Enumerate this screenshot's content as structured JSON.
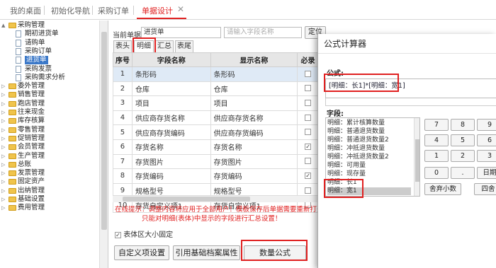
{
  "top_tabs": [
    "我的桌面",
    "初始化导航",
    "采购订单",
    "单据设计"
  ],
  "tree": [
    {
      "label": "采购管理",
      "type": "folder",
      "depth": 1,
      "expand": "▲"
    },
    {
      "label": "期初进货单",
      "type": "doc",
      "depth": 2
    },
    {
      "label": "请购单",
      "type": "doc",
      "depth": 2
    },
    {
      "label": "采购订单",
      "type": "doc",
      "depth": 2
    },
    {
      "label": "进货单",
      "type": "doc",
      "depth": 2,
      "selected": true
    },
    {
      "label": "采购发票",
      "type": "doc",
      "depth": 2
    },
    {
      "label": "采购需求分析",
      "type": "doc",
      "depth": 2
    },
    {
      "label": "委外管理",
      "type": "folder",
      "depth": 1,
      "expand": "▷"
    },
    {
      "label": "销售管理",
      "type": "folder",
      "depth": 1,
      "expand": "▷"
    },
    {
      "label": "跑店管理",
      "type": "folder",
      "depth": 1,
      "expand": "▷"
    },
    {
      "label": "往来现金",
      "type": "folder",
      "depth": 1,
      "expand": "▷"
    },
    {
      "label": "库存核算",
      "type": "folder",
      "depth": 1,
      "expand": "▷"
    },
    {
      "label": "零售管理",
      "type": "folder",
      "depth": 1,
      "expand": "▷"
    },
    {
      "label": "促销管理",
      "type": "folder",
      "depth": 1,
      "expand": "▷"
    },
    {
      "label": "会员管理",
      "type": "folder",
      "depth": 1,
      "expand": "▷"
    },
    {
      "label": "生产管理",
      "type": "folder",
      "depth": 1,
      "expand": "▷"
    },
    {
      "label": "总账",
      "type": "folder",
      "depth": 1,
      "expand": "▷"
    },
    {
      "label": "发票管理",
      "type": "folder",
      "depth": 1,
      "expand": "▷"
    },
    {
      "label": "固定资产",
      "type": "folder",
      "depth": 1,
      "expand": "▷"
    },
    {
      "label": "出纳管理",
      "type": "folder",
      "depth": 1,
      "expand": "▷"
    },
    {
      "label": "基础设置",
      "type": "folder",
      "depth": 1,
      "expand": "▷"
    },
    {
      "label": "费用管理",
      "type": "folder",
      "depth": 1,
      "expand": "▷"
    }
  ],
  "main": {
    "current_label": "当前单据",
    "current_value": "进货单",
    "field_placeholder": "请输入字段名称",
    "locate_label": "定位",
    "subtabs": [
      "表头",
      "明细",
      "汇总",
      "表尾"
    ],
    "columns": [
      "序号",
      "字段名称",
      "显示名称",
      "必录"
    ],
    "rows": [
      {
        "no": "1",
        "field": "条形码",
        "display": "条形码",
        "req": false,
        "hl": true
      },
      {
        "no": "2",
        "field": "仓库",
        "display": "仓库",
        "req": false
      },
      {
        "no": "3",
        "field": "项目",
        "display": "项目",
        "req": false
      },
      {
        "no": "4",
        "field": "供应商存货名称",
        "display": "供应商存货名称",
        "req": false
      },
      {
        "no": "5",
        "field": "供应商存货编码",
        "display": "供应商存货编码",
        "req": false
      },
      {
        "no": "6",
        "field": "存货名称",
        "display": "存货名称",
        "req": true
      },
      {
        "no": "7",
        "field": "存货图片",
        "display": "存货图片",
        "req": false
      },
      {
        "no": "8",
        "field": "存货编码",
        "display": "存货编码",
        "req": true
      },
      {
        "no": "9",
        "field": "规格型号",
        "display": "规格型号",
        "req": false
      },
      {
        "no": "10",
        "field": "存货自定义项1",
        "display": "存货自定义项1",
        "req": false
      }
    ],
    "hint_line1": "在线提示：调整内容将应用于全部用户！模板保存后单据需要重新打开才生",
    "hint_line2": "只能对明细(表体)中显示的字段进行汇总设置！",
    "fixed_size_label": "表体区大小固定",
    "buttons": [
      "自定义项设置",
      "引用基础档案属性",
      "数量公式"
    ]
  },
  "dialog": {
    "title": "公式计算器",
    "formula_label": "公式:",
    "formula_value": "[明细：长1]*[明细：宽1]",
    "fields_label": "字段:",
    "fields": [
      "明细：累计核算数量",
      "明细：普通退货数量",
      "明细：普通退货数量2",
      "明细：冲抵退货数量",
      "明细：冲抵退货数量2",
      "明细：可用量",
      "明细：现存量",
      "明细：长1",
      "明细：宽1"
    ],
    "keys": [
      [
        "7",
        "8",
        "9"
      ],
      [
        "4",
        "5",
        "6"
      ],
      [
        "1",
        "2",
        "3"
      ],
      [
        "0",
        ".",
        "日期"
      ]
    ],
    "round_label": "舍弃小数",
    "round_label2": "四舍"
  }
}
